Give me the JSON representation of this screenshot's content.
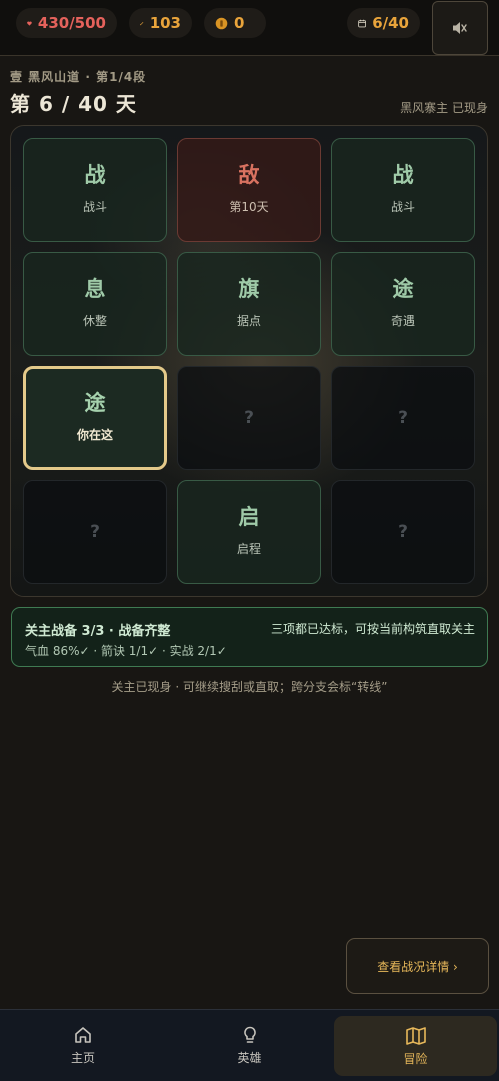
{
  "status": {
    "hp": "430/500",
    "power": "103",
    "coins": "0",
    "day": "6/40"
  },
  "icons": {
    "hp": "heart-icon",
    "power": "brush-icon",
    "coins": "coin-icon",
    "day": "calendar-icon",
    "sound": "speaker-muted-icon"
  },
  "colors": {
    "accent": "#e7b85a",
    "hp": "#e5625c",
    "ready_border": "#3f7a52",
    "enemy": "#d97260",
    "current_border": "#e3c98a"
  },
  "stage": {
    "subtitle": "壹 黑风山道 · 第1/4段",
    "day_title": "第 6 / 40 天",
    "boss_status": "黑风寨主 已现身"
  },
  "map": {
    "tiles": [
      {
        "glyph": "战",
        "label": "战斗",
        "kind": "normal"
      },
      {
        "glyph": "敌",
        "label": "第10天",
        "kind": "enemy"
      },
      {
        "glyph": "战",
        "label": "战斗",
        "kind": "normal"
      },
      {
        "glyph": "息",
        "label": "休整",
        "kind": "normal"
      },
      {
        "glyph": "旗",
        "label": "据点",
        "kind": "normal"
      },
      {
        "glyph": "途",
        "label": "奇遇",
        "kind": "normal"
      },
      {
        "glyph": "途",
        "label": "你在这",
        "kind": "current"
      },
      {
        "glyph": "?",
        "label": "",
        "kind": "unknown"
      },
      {
        "glyph": "?",
        "label": "",
        "kind": "unknown"
      },
      {
        "glyph": "?",
        "label": "",
        "kind": "unknown"
      },
      {
        "glyph": "启",
        "label": "启程",
        "kind": "normal"
      },
      {
        "glyph": "?",
        "label": "",
        "kind": "unknown"
      }
    ]
  },
  "readiness": {
    "title": "关主战备 3/3 · 战备齐整",
    "stats": "气血 86%✓ · 箭诀 1/1✓ · 实战 2/1✓",
    "note": "三项都已达标，可按当前构筑直取关主"
  },
  "hint": "关主已现身 · 可继续搜刮或直取；跨分支会标“转线”",
  "detail_button": "查看战况详情 ›",
  "nav": {
    "home": "主页",
    "hero": "英雄",
    "adventure": "冒险",
    "active": "adventure"
  }
}
